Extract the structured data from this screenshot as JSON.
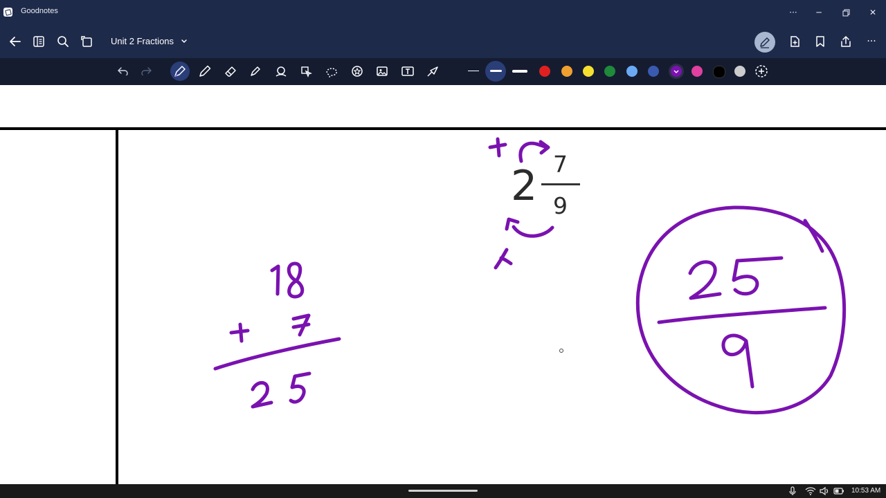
{
  "window": {
    "app_title": "Goodnotes"
  },
  "titlebar": {
    "more": "···",
    "minimize": "─",
    "close": "✕"
  },
  "nav": {
    "doc_title": "Unit 2 Fractions",
    "more": "···"
  },
  "toolbar": {
    "tools": [
      "undo-icon",
      "redo-icon",
      "pen-icon",
      "pencil-icon",
      "eraser-icon",
      "highlighter-icon",
      "shapes-icon",
      "hand-icon",
      "lasso-icon",
      "sticker-icon",
      "image-icon",
      "text-icon",
      "laser-icon"
    ],
    "active_tool": "pen-icon",
    "colors": [
      "#e02020",
      "#f0a030",
      "#f5e030",
      "#1e8a3a",
      "#6aaaf5",
      "#3a5ab0",
      "#7a12b0",
      "#e040a0",
      "#000000",
      "#cccccc"
    ],
    "selected_color": "#7a12b0"
  },
  "canvas": {
    "ink_color": "#7a12b0",
    "printed_whole": "2",
    "printed_numerator": "7",
    "printed_denominator": "9",
    "sum_top": "18",
    "sum_bottom_sign": "+",
    "sum_addend": "7",
    "sum_result": "25",
    "multiply_sign": "×",
    "add_sign": "+",
    "answer_numerator": "25",
    "answer_denominator": "9"
  },
  "taskbar": {
    "time": "10:53 AM"
  }
}
